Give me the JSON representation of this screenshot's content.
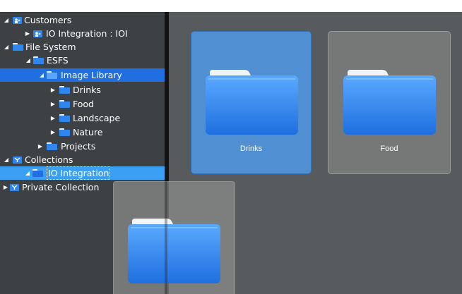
{
  "tree": {
    "rows": [
      {
        "label": "Customers",
        "expanded": true,
        "icon": "customers-icon"
      },
      {
        "label": "IO Integration : IOI",
        "expanded": false,
        "icon": "customers-icon"
      },
      {
        "label": "File System",
        "expanded": true,
        "icon": "folder-icon"
      },
      {
        "label": "ESFS",
        "expanded": true,
        "icon": "folder-icon"
      },
      {
        "label": "Image Library",
        "expanded": true,
        "icon": "folder-icon"
      },
      {
        "label": "Drinks",
        "expanded": false,
        "icon": "folder-icon"
      },
      {
        "label": "Food",
        "expanded": false,
        "icon": "folder-icon"
      },
      {
        "label": "Landscape",
        "expanded": false,
        "icon": "folder-icon"
      },
      {
        "label": "Nature",
        "expanded": false,
        "icon": "folder-icon"
      },
      {
        "label": "Projects",
        "expanded": false,
        "icon": "folder-icon"
      },
      {
        "label": "Collections",
        "expanded": true,
        "icon": "collection-icon"
      },
      {
        "label": "IO Integration",
        "expanded": true,
        "icon": "folder-icon"
      },
      {
        "label": "Private Collection",
        "expanded": false,
        "icon": "collection-icon"
      }
    ]
  },
  "tiles": [
    {
      "label": "Drinks",
      "selected": true
    },
    {
      "label": "Food",
      "selected": false
    }
  ],
  "colors": {
    "selection_dark": "#1f6fe0",
    "selection_light": "#3ba0f3",
    "folder_blue": "#2f86ee",
    "sidebar_bg": "#3d4143",
    "content_bg": "#575b5d"
  },
  "icons": {
    "expand": "triangle-down",
    "collapse": "triangle-right"
  }
}
